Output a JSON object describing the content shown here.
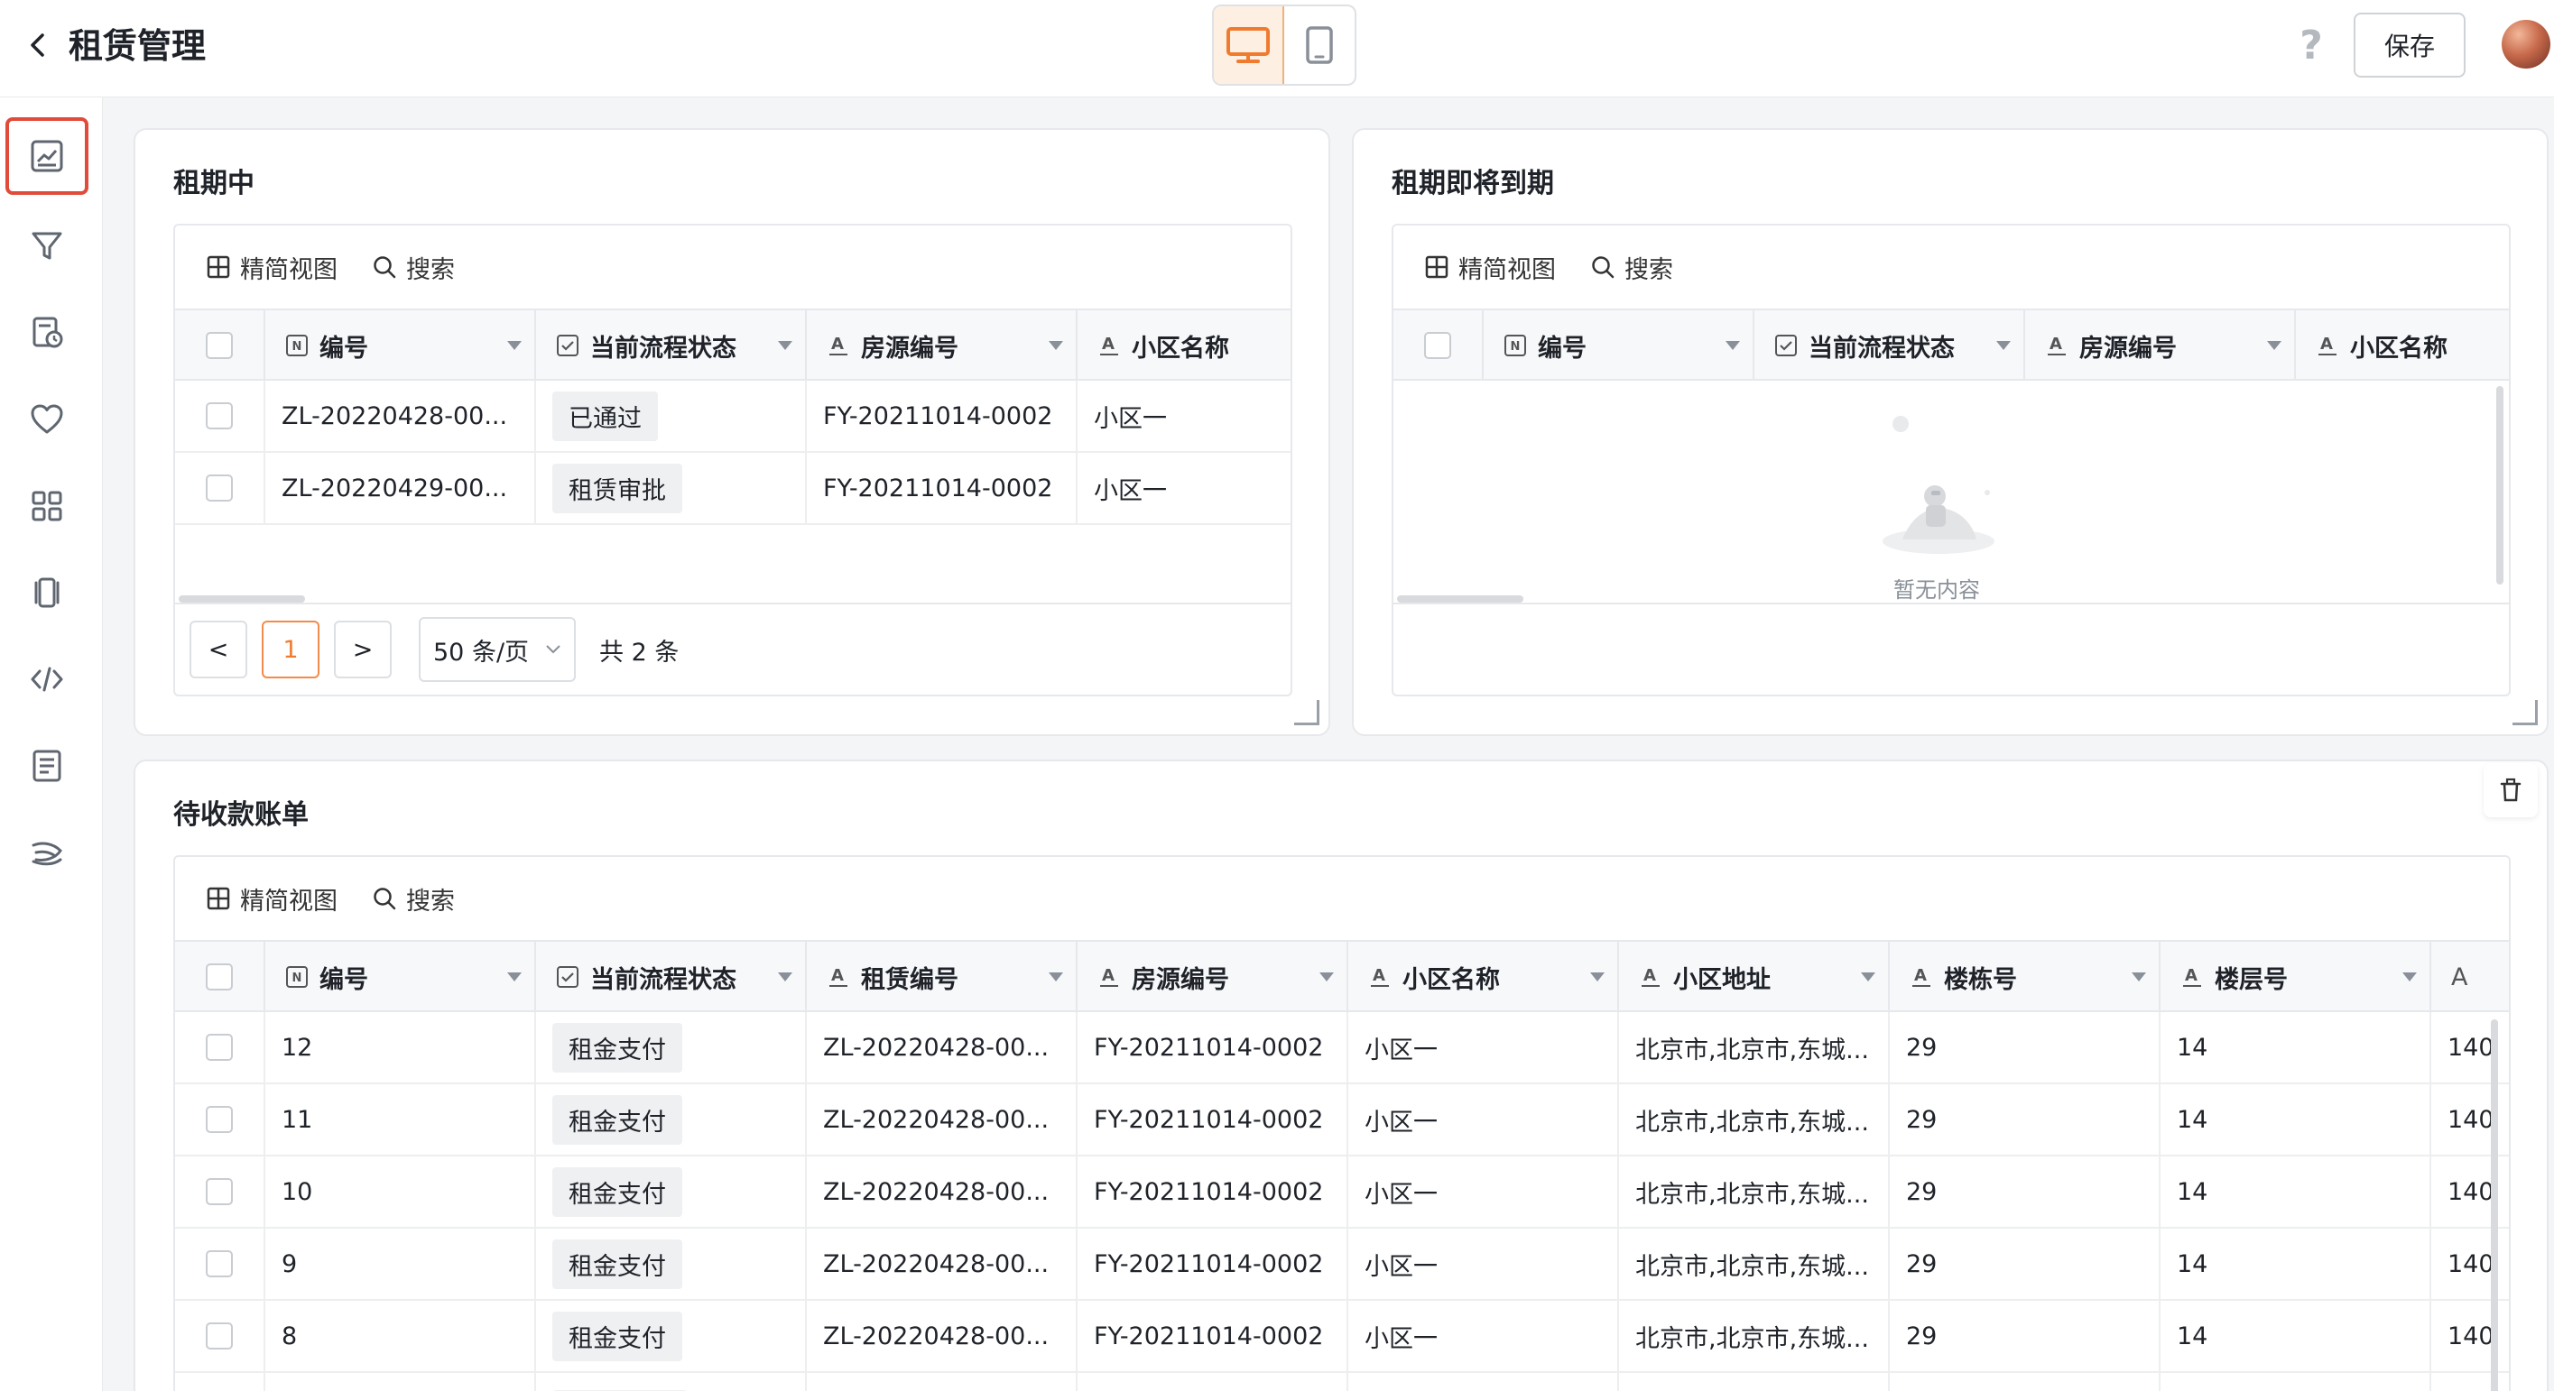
{
  "header": {
    "title": "租赁管理",
    "save_label": "保存",
    "help_glyph": "?"
  },
  "toolbar": {
    "compact_view": "精简视图",
    "search": "搜索"
  },
  "panel_active": {
    "title": "租期中",
    "columns": [
      "编号",
      "当前流程状态",
      "房源编号",
      "小区名称"
    ],
    "rows": [
      {
        "id": "ZL-20220428-00...",
        "status": "已通过",
        "house": "FY-20211014-0002",
        "community": "小区一"
      },
      {
        "id": "ZL-20220429-00...",
        "status": "租赁审批",
        "house": "FY-20211014-0002",
        "community": "小区一"
      }
    ],
    "pager": {
      "prev": "<",
      "current": "1",
      "next": ">",
      "page_size": "50 条/页",
      "total": "共 2 条"
    }
  },
  "panel_expiring": {
    "title": "租期即将到期",
    "columns": [
      "编号",
      "当前流程状态",
      "房源编号",
      "小区名称"
    ],
    "empty_text": "暂无内容"
  },
  "panel_bills": {
    "title": "待收款账单",
    "columns": [
      "编号",
      "当前流程状态",
      "租赁编号",
      "房源编号",
      "小区名称",
      "小区地址",
      "楼栋号",
      "楼层号",
      "A"
    ],
    "rows": [
      {
        "id": "12",
        "status": "租金支付",
        "lease": "ZL-20220428-00...",
        "house": "FY-20211014-0002",
        "community": "小区一",
        "address": "北京市,北京市,东城...",
        "building": "29",
        "floor": "14",
        "room": "140"
      },
      {
        "id": "11",
        "status": "租金支付",
        "lease": "ZL-20220428-00...",
        "house": "FY-20211014-0002",
        "community": "小区一",
        "address": "北京市,北京市,东城...",
        "building": "29",
        "floor": "14",
        "room": "140"
      },
      {
        "id": "10",
        "status": "租金支付",
        "lease": "ZL-20220428-00...",
        "house": "FY-20211014-0002",
        "community": "小区一",
        "address": "北京市,北京市,东城...",
        "building": "29",
        "floor": "14",
        "room": "140"
      },
      {
        "id": "9",
        "status": "租金支付",
        "lease": "ZL-20220428-00...",
        "house": "FY-20211014-0002",
        "community": "小区一",
        "address": "北京市,北京市,东城...",
        "building": "29",
        "floor": "14",
        "room": "140"
      },
      {
        "id": "8",
        "status": "租金支付",
        "lease": "ZL-20220428-00...",
        "house": "FY-20211014-0002",
        "community": "小区一",
        "address": "北京市,北京市,东城...",
        "building": "29",
        "floor": "14",
        "room": "140"
      }
    ]
  },
  "colors": {
    "accent": "#f07b2f",
    "sidebar_active_border": "#e04b3a"
  }
}
